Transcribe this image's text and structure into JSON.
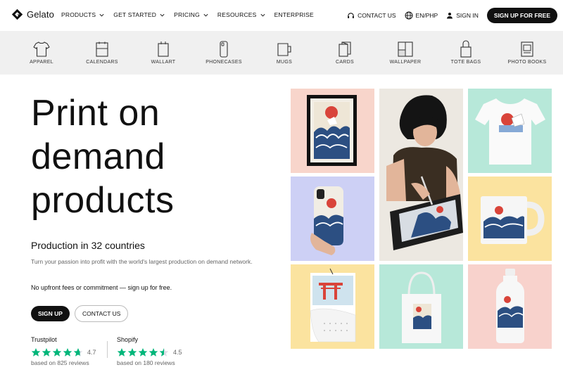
{
  "nav": {
    "logo": "Gelato",
    "menu": [
      "PRODUCTS",
      "GET STARTED",
      "PRICING",
      "RESOURCES",
      "ENTERPRISE"
    ],
    "contact": "CONTACT US",
    "language": "EN/PHP",
    "signin": "SIGN IN",
    "signup": "SIGN UP FOR FREE"
  },
  "categories": [
    {
      "label": "APPAREL",
      "icon": "tshirt-icon"
    },
    {
      "label": "CALENDARS",
      "icon": "calendar-icon"
    },
    {
      "label": "WALLART",
      "icon": "wallart-icon"
    },
    {
      "label": "PHONECASES",
      "icon": "phonecase-icon"
    },
    {
      "label": "MUGS",
      "icon": "mug-icon"
    },
    {
      "label": "CARDS",
      "icon": "cards-icon"
    },
    {
      "label": "WALLPAPER",
      "icon": "wallpaper-icon"
    },
    {
      "label": "TOTE BAGS",
      "icon": "totebag-icon"
    },
    {
      "label": "PHOTO BOOKS",
      "icon": "photobook-icon"
    }
  ],
  "hero": {
    "title_lines": [
      "Print on",
      "demand",
      "products"
    ],
    "subhead": "Production in 32 countries",
    "description": "Turn your passion into profit with the world's largest production on demand network.",
    "note": "No upfront fees or commitment — sign up for free.",
    "signup": "SIGN UP",
    "contact": "CONTACT US"
  },
  "reviews": [
    {
      "source": "Trustpilot",
      "score": "4.7",
      "count": "based on 825 reviews",
      "rating": 4.7
    },
    {
      "source": "Shopify",
      "score": "4.5",
      "count": "based on 180 reviews",
      "rating": 4.5
    }
  ],
  "colors": {
    "peach": "#f8d5cb",
    "lavender": "#cdd0f5",
    "yellow": "#fbe39f",
    "mint": "#b7e8d9",
    "pink": "#f8d2cc",
    "star_green": "#00b67a",
    "dark": "#111111"
  }
}
